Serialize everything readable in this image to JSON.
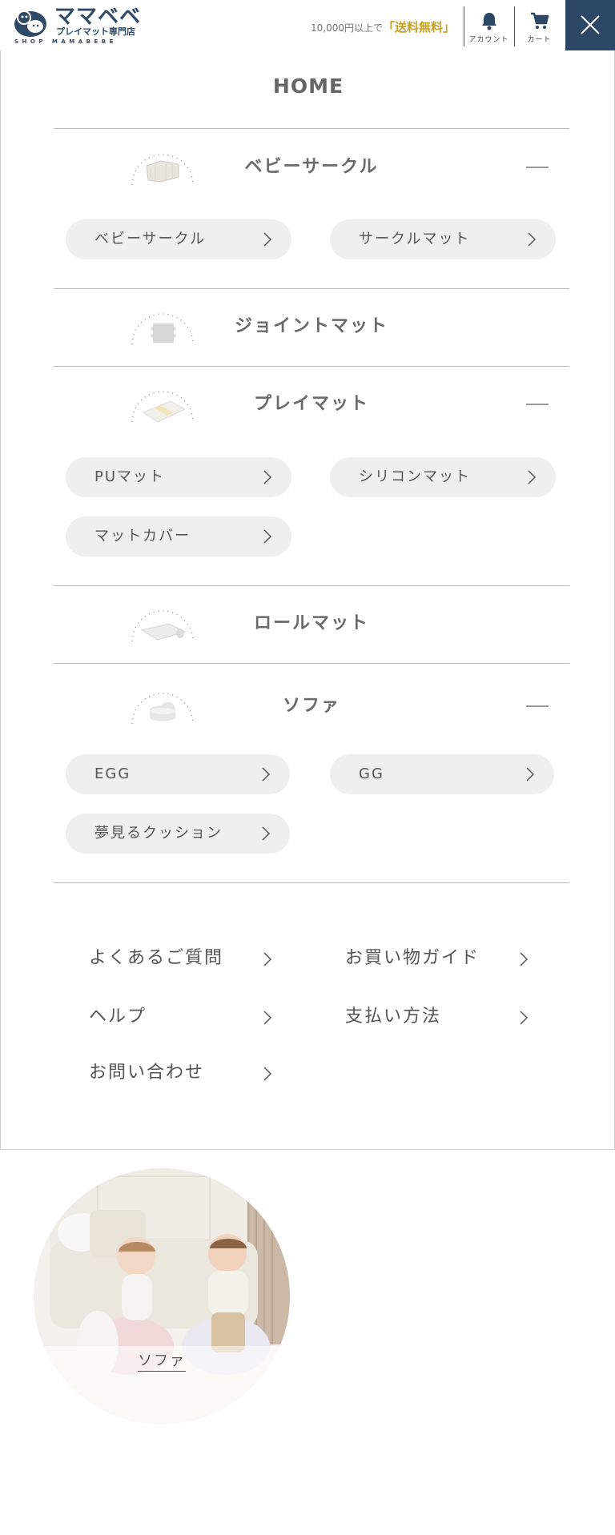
{
  "header": {
    "logo_title": "ママベベ",
    "logo_sub": "プレイマット専門店",
    "logo_en": "SHOP MAMABEBE",
    "promo_text": "10,000円以上で",
    "promo_highlight": "「送料無料」",
    "account_label": "アカウント",
    "cart_label": "カート"
  },
  "menu": {
    "home_label": "HOME",
    "categories": [
      {
        "label": "ベビーサークル",
        "icon": "baby-circle-icon",
        "expanded": true
      },
      {
        "label": "ジョイントマット",
        "icon": "joint-mat-icon",
        "expanded": false
      },
      {
        "label": "プレイマット",
        "icon": "play-mat-icon",
        "expanded": true
      },
      {
        "label": "ロールマット",
        "icon": "roll-mat-icon",
        "expanded": false
      },
      {
        "label": "ソファ",
        "icon": "sofa-icon",
        "expanded": true
      }
    ],
    "sub_baby_circle": [
      "ベビーサークル",
      "サークルマット"
    ],
    "sub_play_mat": [
      "PUマット",
      "シリコンマット",
      "マットカバー"
    ],
    "sub_sofa": [
      "EGG",
      "GG",
      "夢見るクッション"
    ],
    "links": [
      "よくあるご質問",
      "お買い物ガイド",
      "ヘルプ",
      "支払い方法",
      "お問い合わせ"
    ]
  },
  "feature": {
    "label": "ソファ"
  },
  "colors": {
    "brand": "#2d4866",
    "promo": "#c9a227",
    "pill_bg": "#efefef"
  }
}
